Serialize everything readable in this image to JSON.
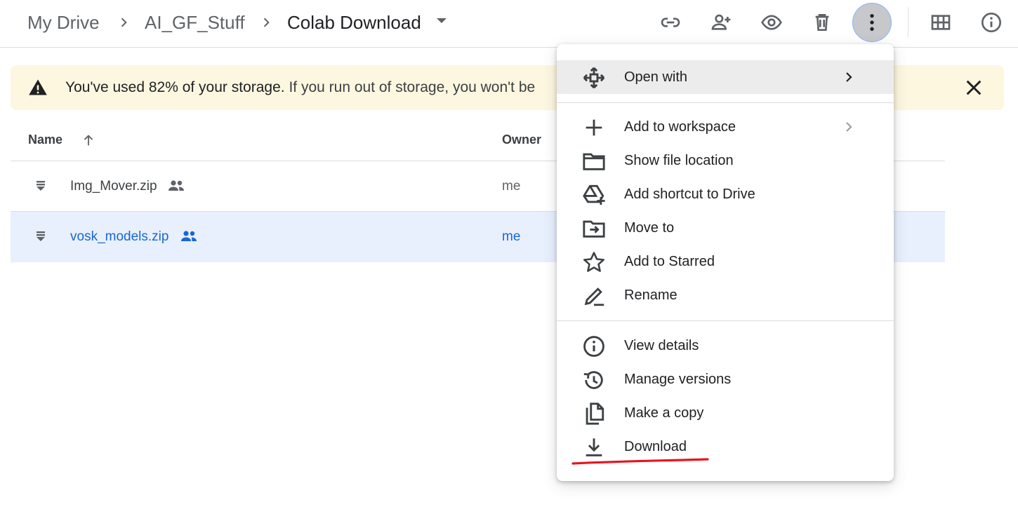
{
  "breadcrumb": {
    "items": [
      "My Drive",
      "AI_GF_Stuff",
      "Colab Download"
    ]
  },
  "toolbar": {
    "icons": [
      "link-icon",
      "share-icon",
      "preview-icon",
      "trash-icon",
      "more-vert-icon",
      "grid-view-icon",
      "info-icon"
    ]
  },
  "banner": {
    "bold_text": "You've used 82% of your storage.",
    "text": "If you run out of storage, you won't be"
  },
  "list": {
    "name_header": "Name",
    "owner_header": "Owner",
    "rows": [
      {
        "name": "Img_Mover.zip",
        "owner": "me",
        "shared": true,
        "selected": false
      },
      {
        "name": "vosk_models.zip",
        "owner": "me",
        "shared": true,
        "selected": true
      }
    ]
  },
  "menu": {
    "items": [
      {
        "label": "Open with",
        "icon": "open-with-icon",
        "submenu": true
      },
      {
        "label": "Add to workspace",
        "icon": "plus-icon",
        "submenu": true
      },
      {
        "label": "Show file location",
        "icon": "folder-icon",
        "submenu": false
      },
      {
        "label": "Add shortcut to Drive",
        "icon": "add-shortcut-icon",
        "submenu": false
      },
      {
        "label": "Move to",
        "icon": "move-to-icon",
        "submenu": false
      },
      {
        "label": "Add to Starred",
        "icon": "star-icon",
        "submenu": false
      },
      {
        "label": "Rename",
        "icon": "rename-icon",
        "submenu": false
      },
      {
        "label": "View details",
        "icon": "info-icon",
        "submenu": false
      },
      {
        "label": "Manage versions",
        "icon": "history-icon",
        "submenu": false
      },
      {
        "label": "Make a copy",
        "icon": "copy-icon",
        "submenu": false
      },
      {
        "label": "Download",
        "icon": "download-icon",
        "submenu": false
      }
    ]
  },
  "colors": {
    "selected_row": "#e8f0fe",
    "selected_text": "#1967d2",
    "banner_bg": "#fef7e0",
    "annotation": "#e8141d"
  }
}
